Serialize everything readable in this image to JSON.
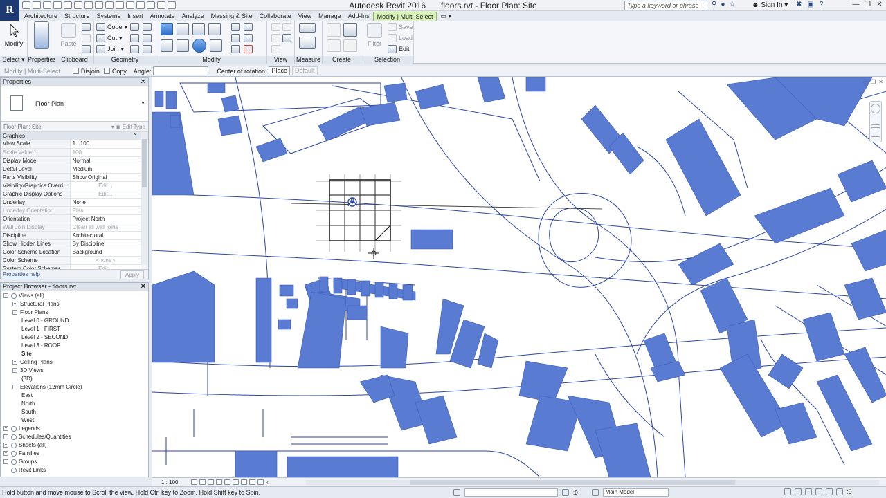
{
  "app": {
    "title": "Autodesk Revit 2016",
    "file_title": "floors.rvt - Floor Plan: Site",
    "logo": "R",
    "search_placeholder": "Type a keyword or phrase",
    "sign_in": "Sign In"
  },
  "ribbon": {
    "tabs": [
      "Architecture",
      "Structure",
      "Systems",
      "Insert",
      "Annotate",
      "Analyze",
      "Massing & Site",
      "Collaborate",
      "View",
      "Manage",
      "Add-Ins",
      "Modify | Multi-Select"
    ],
    "active_tab": "Modify | Multi-Select",
    "modify_label": "Modify",
    "paste_label": "Paste",
    "filter_label": "Filter",
    "cope_label": "Cope",
    "cut_label": "Cut",
    "join_label": "Join",
    "save_label": "Save",
    "load_label": "Load",
    "edit_label": "Edit",
    "panels": {
      "select": "Select",
      "properties": "Properties",
      "clipboard": "Clipboard",
      "geometry": "Geometry",
      "modify": "Modify",
      "view": "View",
      "measure": "Measure",
      "create": "Create",
      "selection": "Selection"
    }
  },
  "options_bar": {
    "context": "Modify | Multi-Select",
    "disjoin": "Disjoin",
    "copy": "Copy",
    "angle_label": "Angle:",
    "center_label": "Center of rotation:",
    "place": "Place",
    "default": "Default"
  },
  "properties": {
    "title": "Properties",
    "type_name": "Floor Plan",
    "instance": "Floor Plan: Site",
    "edit_type": "Edit Type",
    "group": "Graphics",
    "rows": [
      {
        "key": "View Scale",
        "value": "1 : 100"
      },
      {
        "key": "Scale Value    1:",
        "value": "100"
      },
      {
        "key": "Display Model",
        "value": "Normal"
      },
      {
        "key": "Detail Level",
        "value": "Medium"
      },
      {
        "key": "Parts Visibility",
        "value": "Show Original"
      },
      {
        "key": "Visibility/Graphics Overri...",
        "value": "Edit..."
      },
      {
        "key": "Graphic Display Options",
        "value": "Edit..."
      },
      {
        "key": "Underlay",
        "value": "None"
      },
      {
        "key": "Underlay Orientation",
        "value": "Plan"
      },
      {
        "key": "Orientation",
        "value": "Project North"
      },
      {
        "key": "Wall Join Display",
        "value": "Clean all wall joins"
      },
      {
        "key": "Discipline",
        "value": "Architectural"
      },
      {
        "key": "Show Hidden Lines",
        "value": "By Discipline"
      },
      {
        "key": "Color Scheme Location",
        "value": "Background"
      },
      {
        "key": "Color Scheme",
        "value": "<none>"
      },
      {
        "key": "System Color Schemes",
        "value": "Edit..."
      }
    ],
    "help": "Properties help",
    "apply": "Apply"
  },
  "browser": {
    "title": "Project Browser - floors.rvt",
    "items": [
      {
        "label": "Views (all)",
        "level": 0,
        "toggle": "-",
        "icon": true
      },
      {
        "label": "Structural Plans",
        "level": 1,
        "toggle": "+"
      },
      {
        "label": "Floor Plans",
        "level": 1,
        "toggle": "-"
      },
      {
        "label": "Level 0 - GROUND",
        "level": 2
      },
      {
        "label": "Level 1 - FIRST",
        "level": 2
      },
      {
        "label": "Level 2 - SECOND",
        "level": 2
      },
      {
        "label": "Level 3 - ROOF",
        "level": 2
      },
      {
        "label": "Site",
        "level": 2,
        "bold": true
      },
      {
        "label": "Ceiling Plans",
        "level": 1,
        "toggle": "+"
      },
      {
        "label": "3D Views",
        "level": 1,
        "toggle": "-"
      },
      {
        "label": "{3D}",
        "level": 2
      },
      {
        "label": "Elevations (12mm Circle)",
        "level": 1,
        "toggle": "-"
      },
      {
        "label": "East",
        "level": 2
      },
      {
        "label": "North",
        "level": 2
      },
      {
        "label": "South",
        "level": 2
      },
      {
        "label": "West",
        "level": 2
      },
      {
        "label": "Legends",
        "level": 0,
        "toggle": "+",
        "icon": true
      },
      {
        "label": "Schedules/Quantities",
        "level": 0,
        "toggle": "+",
        "icon": true
      },
      {
        "label": "Sheets (all)",
        "level": 0,
        "toggle": "+",
        "icon": true
      },
      {
        "label": "Families",
        "level": 0,
        "toggle": "+",
        "icon": true
      },
      {
        "label": "Groups",
        "level": 0,
        "toggle": "+",
        "icon": true
      },
      {
        "label": "Revit Links",
        "level": 0,
        "icon": true
      }
    ]
  },
  "view_bar": {
    "scale": "1 : 100"
  },
  "status": {
    "message": "Hold button and move mouse to Scroll the view. Hold Ctrl key to Zoom. Hold Shift key to Spin.",
    "coord": ":0",
    "model": "Main Model"
  },
  "colors": {
    "building_fill": "#5a7bd2",
    "linework": "#2c46a8",
    "ribbon_active": "#d9f2b9"
  }
}
